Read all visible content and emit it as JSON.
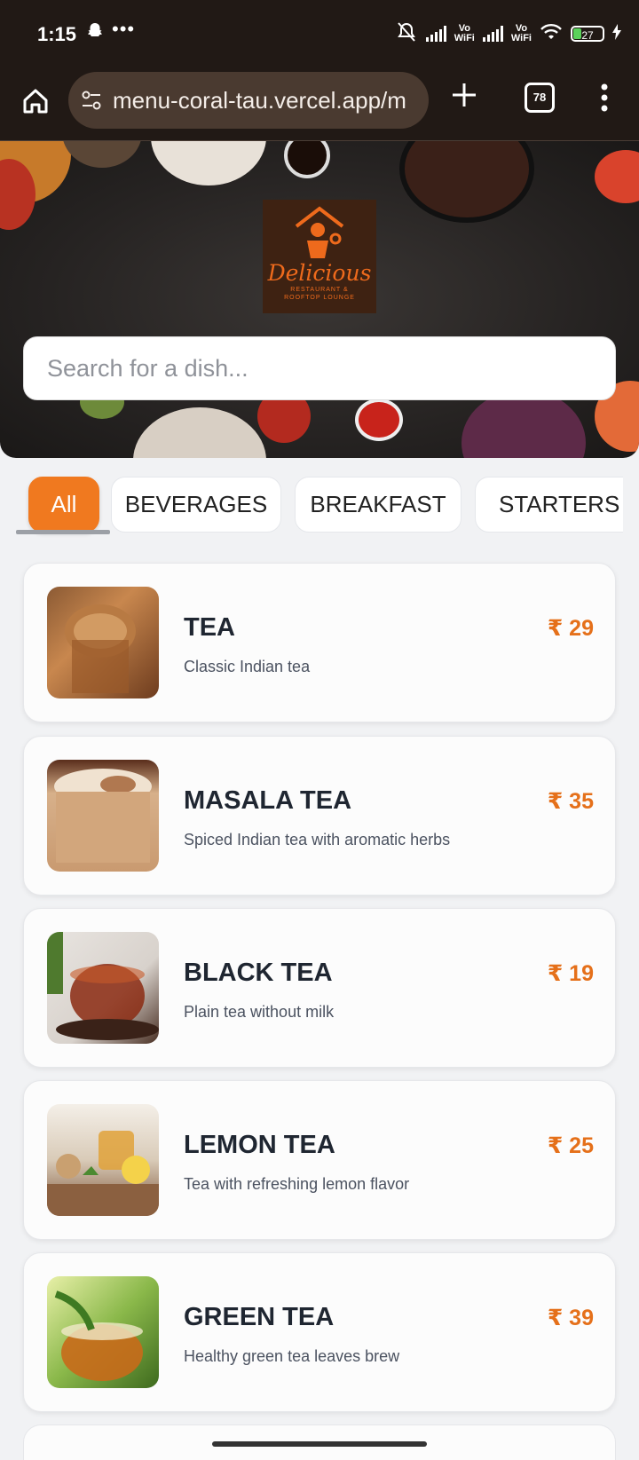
{
  "status_bar": {
    "time": "1:15",
    "vowifi_label_1": "Vo\nWiFi",
    "vowifi_label_2": "Vo\nWiFi",
    "battery": "27"
  },
  "browser": {
    "url": "menu-coral-tau.vercel.app/m",
    "tab_count": "78"
  },
  "hero": {
    "brand_name": "Delicious",
    "brand_tagline_1": "RESTAURANT &",
    "brand_tagline_2": "ROOFTOP LOUNGE",
    "search_placeholder": "Search for a dish..."
  },
  "categories": [
    {
      "label": "All",
      "active": true
    },
    {
      "label": "BEVERAGES",
      "active": false
    },
    {
      "label": "BREAKFAST",
      "active": false
    },
    {
      "label": "STARTERS (",
      "active": false
    }
  ],
  "menu_items": [
    {
      "name": "TEA",
      "description": "Classic Indian tea",
      "price": "₹ 29"
    },
    {
      "name": "MASALA TEA",
      "description": "Spiced Indian tea with aromatic herbs",
      "price": "₹ 35"
    },
    {
      "name": "BLACK TEA",
      "description": "Plain tea without milk",
      "price": "₹ 19"
    },
    {
      "name": "LEMON TEA",
      "description": "Tea with refreshing lemon flavor",
      "price": "₹ 25"
    },
    {
      "name": "GREEN TEA",
      "description": "Healthy green tea leaves brew",
      "price": "₹ 39"
    }
  ],
  "colors": {
    "accent": "#f0791f",
    "price": "#e5701a",
    "browser_chrome": "#211915"
  }
}
